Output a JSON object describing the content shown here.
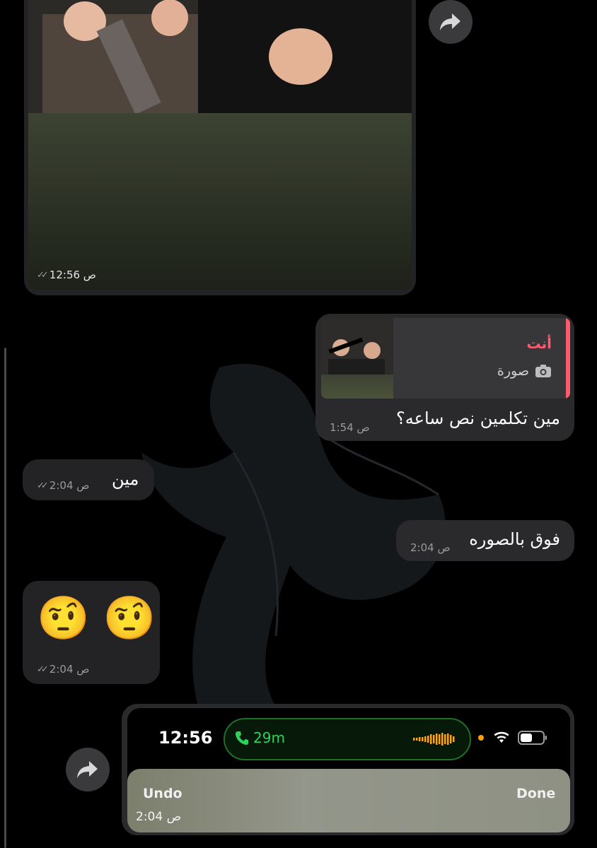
{
  "messages": {
    "image_top": {
      "time": "12:56 ص"
    },
    "reply": {
      "sender": "أنت",
      "type_label": "صورة",
      "text": "مين تكلمين نص ساعه؟",
      "time": "1:54 ص"
    },
    "in1": {
      "text": "مين",
      "time": "2:04 ص"
    },
    "out1": {
      "text": "فوق بالصوره",
      "time": "2:04 ص"
    },
    "emoji": {
      "text": "🤨 🤨",
      "time": "2:04 ص"
    },
    "screenshot": {
      "status_time": "12:56",
      "call_duration": "29m",
      "undo": "Undo",
      "done": "Done",
      "time": "2:04 ص"
    }
  },
  "colors": {
    "reply_accent": "#ff5a6e",
    "call_green": "#30d158",
    "waveform": "#f5a623"
  },
  "icons": [
    "forward-icon",
    "camera-icon",
    "double-check-icon",
    "phone-icon",
    "wifi-icon",
    "battery-icon"
  ]
}
